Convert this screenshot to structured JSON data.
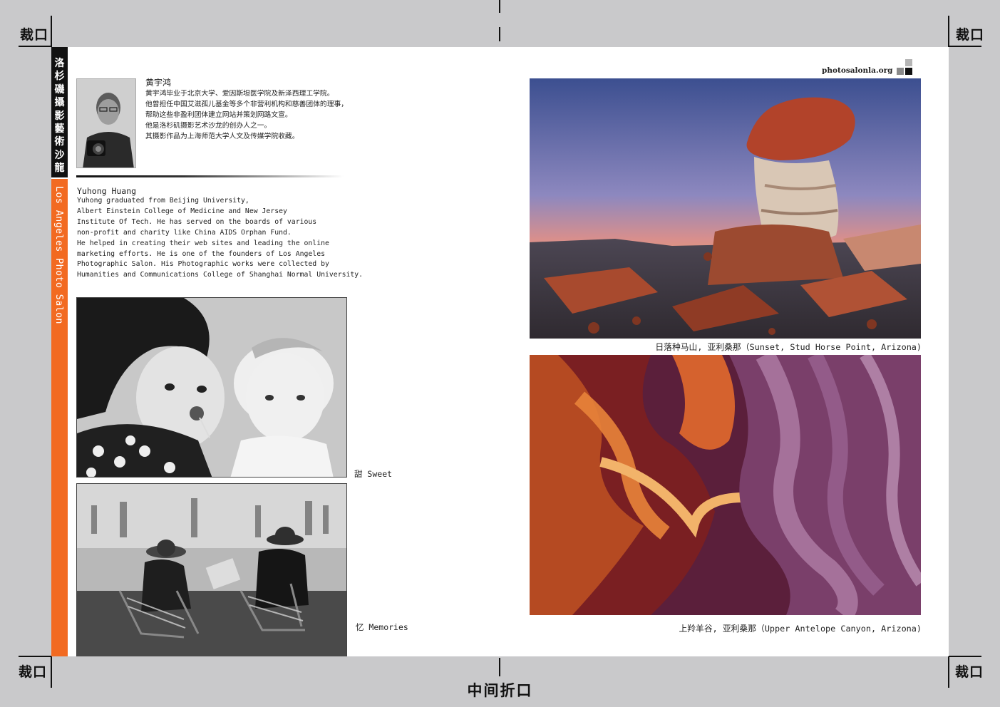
{
  "crop_marks": {
    "corner_label": "裁口",
    "center_fold_label": "中间折口"
  },
  "sidebar": {
    "chinese_title": "洛杉磯攝影藝術沙龍",
    "english_title": "Los Angeles Photo Salon",
    "accent_color": "#f26a21"
  },
  "bio": {
    "cn_name": "黄宇鸿",
    "cn_lines": [
      "黄宇鸿毕业于北京大学、爱因斯坦医学院及新泽西理工学院。",
      "他曾担任中国艾滋孤儿基金等多个非营利机构和慈善团体的理事，",
      "帮助这些非盈利团体建立网站并策划网路文宣。",
      "他是洛杉矶摄影艺术沙龙的创办人之一。",
      "其摄影作品为上海师范大学人文及传媒学院收藏。"
    ],
    "en_name": "Yuhong Huang",
    "en_lines": [
      "Yuhong graduated from Beijing University,",
      "Albert Einstein College of Medicine and New Jersey",
      "Institute Of Tech. He has served on the boards of various",
      "non-profit and charity like China AIDS Orphan Fund.",
      "He helped in creating their web sites and leading the online",
      "marketing efforts. He is one of the founders of Los Angeles",
      "Photographic Salon. His Photographic works were collected by",
      "Humanities and Communications College of Shanghai Normal University."
    ]
  },
  "photos_left": [
    {
      "caption": "甜 Sweet"
    },
    {
      "caption": "忆 Memories"
    }
  ],
  "right_page": {
    "site": "photosalonla.org",
    "photos": [
      {
        "caption": "日落种马山, 亚利桑那（Sunset, Stud Horse Point, Arizona)"
      },
      {
        "caption": "上羚羊谷, 亚利桑那（Upper Antelope Canyon,  Arizona)"
      }
    ]
  }
}
